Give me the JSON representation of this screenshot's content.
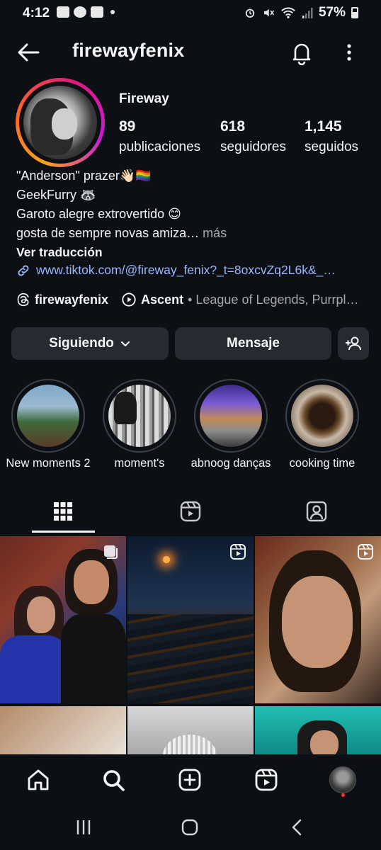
{
  "status_bar": {
    "time": "4:12",
    "battery": "57%"
  },
  "header": {
    "username": "firewayfenix"
  },
  "profile": {
    "display_name": "Fireway",
    "stats": {
      "posts_count": "89",
      "posts_label": "publicaciones",
      "followers_count": "618",
      "followers_label": "seguidores",
      "following_count": "1,145",
      "following_label": "seguidos"
    },
    "bio": {
      "line1": "\"Anderson\"  prazer👋🏻🏳️‍🌈",
      "line2": "GeekFurry 🦝",
      "line3": "Garoto alegre extrovertido 😊",
      "line4": "gosta de sempre novas amiza…",
      "more": " más",
      "translate": "Ver traducción",
      "link": "www.tiktok.com/@fireway_fenix?_t=8oxcvZq2L6k&_…"
    },
    "threads": {
      "handle": "firewayfenix",
      "music_title": "Ascent",
      "music_rest": "• League of Legends, Purrpl…"
    }
  },
  "actions": {
    "following_label": "Siguiendo",
    "message_label": "Mensaje"
  },
  "highlights": [
    {
      "label": "New moments 2"
    },
    {
      "label": "moment's"
    },
    {
      "label": "abnoog danças"
    },
    {
      "label": "cooking time"
    }
  ],
  "colors": {
    "background": "#0c0f14",
    "button": "#262a31",
    "link": "#9bb8ff",
    "muted": "#a8a8a8",
    "notification_dot": "#ff3040"
  }
}
